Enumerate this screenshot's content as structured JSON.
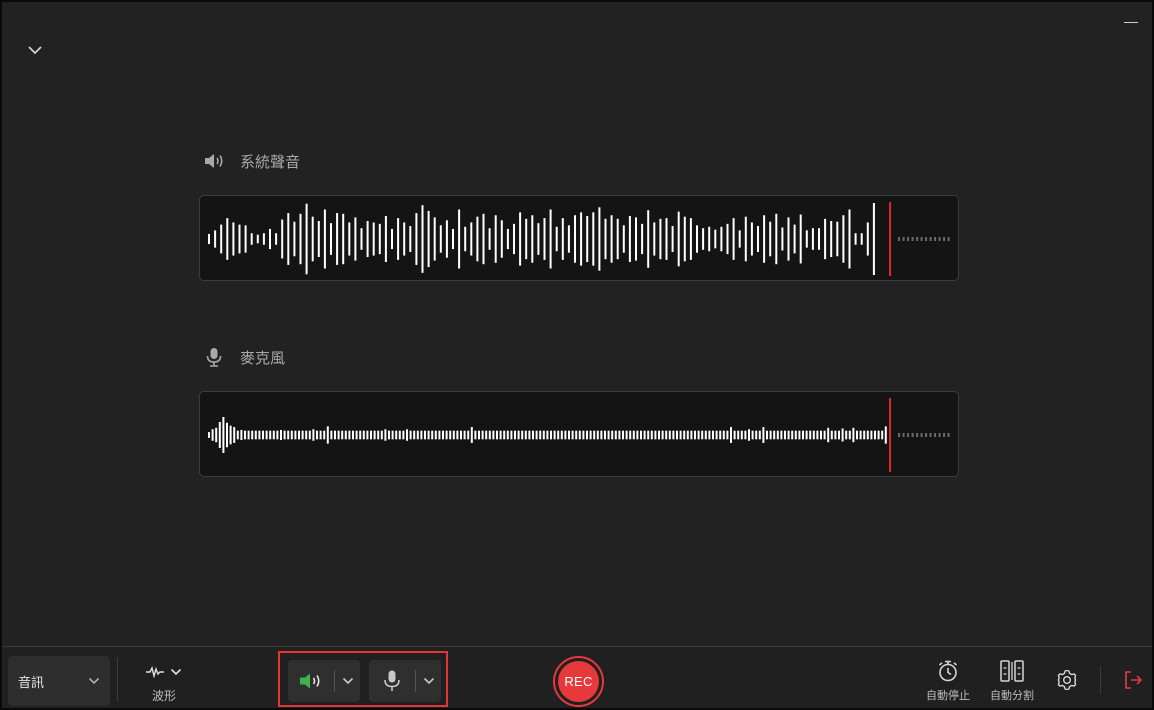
{
  "tracks": {
    "system": {
      "label": "系統聲音",
      "icon": "speaker-icon",
      "bars": [
        0.14,
        0.24,
        0.4,
        0.58,
        0.46,
        0.4,
        0.38,
        0.16,
        0.12,
        0.16,
        0.28,
        0.16,
        0.54,
        0.72,
        0.48,
        0.7,
        0.98,
        0.62,
        0.5,
        0.82,
        0.44,
        0.72,
        0.7,
        0.46,
        0.6,
        0.3,
        0.5,
        0.46,
        0.42,
        0.64,
        0.28,
        0.58,
        0.46,
        0.36,
        0.72,
        0.94,
        0.78,
        0.6,
        0.38,
        0.52,
        0.28,
        0.82,
        0.34,
        0.46,
        0.62,
        0.7,
        0.3,
        0.66,
        0.52,
        0.28,
        0.42,
        0.74,
        0.56,
        0.66,
        0.44,
        0.58,
        0.82,
        0.34,
        0.58,
        0.38,
        0.66,
        0.74,
        0.64,
        0.74,
        0.88,
        0.56,
        0.66,
        0.56,
        0.38,
        0.64,
        0.6,
        0.42,
        0.8,
        0.46,
        0.56,
        0.58,
        0.36,
        0.76,
        0.62,
        0.58,
        0.38,
        0.3,
        0.34,
        0.26,
        0.34,
        0.42,
        0.58,
        0.24,
        0.62,
        0.46,
        0.36,
        0.66,
        0.48,
        0.7,
        0.32,
        0.6,
        0.4,
        0.68,
        0.24,
        0.3,
        0.3,
        0.56,
        0.5,
        0.48,
        0.66,
        0.82,
        0.16,
        0.16,
        0.46,
        1.0
      ],
      "playhead": 0.908
    },
    "microphone": {
      "label": "麥克風",
      "icon": "microphone-icon",
      "bars": [
        0.08,
        0.16,
        0.2,
        0.36,
        0.5,
        0.34,
        0.26,
        0.22,
        0.12,
        0.14,
        0.12,
        0.12,
        0.12,
        0.12,
        0.12,
        0.12,
        0.12,
        0.12,
        0.12,
        0.12,
        0.14,
        0.12,
        0.12,
        0.12,
        0.12,
        0.12,
        0.12,
        0.12,
        0.12,
        0.16,
        0.12,
        0.12,
        0.12,
        0.24,
        0.12,
        0.12,
        0.12,
        0.12,
        0.12,
        0.12,
        0.12,
        0.12,
        0.12,
        0.12,
        0.12,
        0.12,
        0.12,
        0.12,
        0.12,
        0.16,
        0.12,
        0.12,
        0.12,
        0.12,
        0.12,
        0.16,
        0.12,
        0.12,
        0.12,
        0.12,
        0.12,
        0.12,
        0.12,
        0.12,
        0.12,
        0.12,
        0.12,
        0.12,
        0.12,
        0.12,
        0.12,
        0.12,
        0.12,
        0.22,
        0.12,
        0.12,
        0.12,
        0.12,
        0.12,
        0.12,
        0.12,
        0.12,
        0.12,
        0.12,
        0.12,
        0.12,
        0.12,
        0.12,
        0.12,
        0.12,
        0.12,
        0.12,
        0.12,
        0.12,
        0.12,
        0.12,
        0.12,
        0.12,
        0.12,
        0.12,
        0.12,
        0.12,
        0.12,
        0.12,
        0.12,
        0.12,
        0.12,
        0.12,
        0.12,
        0.12,
        0.12,
        0.12,
        0.12,
        0.12,
        0.12,
        0.12,
        0.12,
        0.12,
        0.12,
        0.12,
        0.12,
        0.12,
        0.12,
        0.12,
        0.12,
        0.12,
        0.12,
        0.12,
        0.12,
        0.12,
        0.12,
        0.12,
        0.12,
        0.12,
        0.12,
        0.12,
        0.12,
        0.12,
        0.12,
        0.12,
        0.12,
        0.12,
        0.12,
        0.12,
        0.12,
        0.22,
        0.12,
        0.12,
        0.12,
        0.12,
        0.16,
        0.12,
        0.12,
        0.12,
        0.22,
        0.12,
        0.12,
        0.12,
        0.12,
        0.12,
        0.12,
        0.12,
        0.12,
        0.12,
        0.12,
        0.12,
        0.12,
        0.12,
        0.12,
        0.12,
        0.12,
        0.12,
        0.2,
        0.12,
        0.12,
        0.12,
        0.18,
        0.12,
        0.12,
        0.2,
        0.12,
        0.12,
        0.12,
        0.12,
        0.12,
        0.12,
        0.12,
        0.12,
        0.24
      ],
      "playhead": 0.908
    }
  },
  "bottom_bar": {
    "mode_select": {
      "value": "音訊"
    },
    "wave_mode": {
      "label": "波形"
    },
    "sources": {
      "speaker": {
        "icon": "speaker-icon",
        "active_color": "#3fb24a"
      },
      "mic": {
        "icon": "microphone-icon"
      }
    },
    "rec_label": "REC",
    "auto_stop_label": "自動停止",
    "auto_split_label": "自動分割"
  },
  "colors": {
    "accent_red": "#e5393c",
    "playhead": "#e8252a",
    "speaker_active": "#3fb24a"
  }
}
